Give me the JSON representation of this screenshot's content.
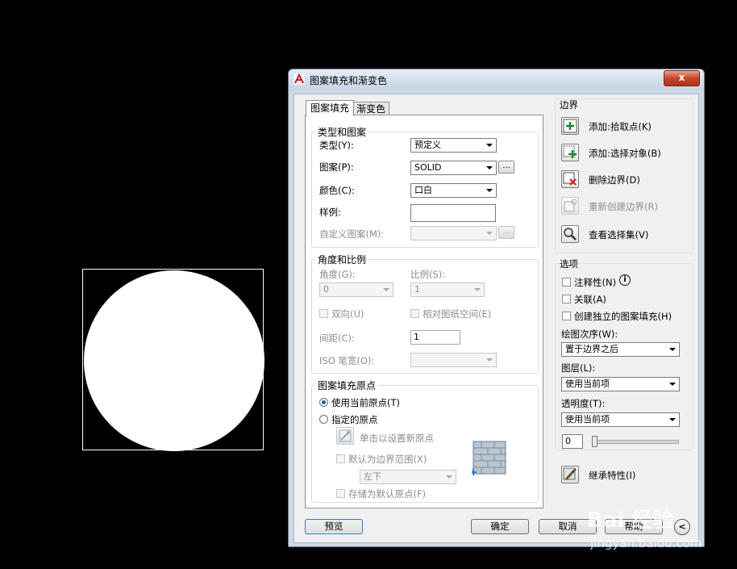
{
  "dialog": {
    "title": "图案填充和渐变色",
    "close_label": "x",
    "tabs": [
      {
        "label": "图案填充"
      },
      {
        "label": "渐变色"
      }
    ]
  },
  "type_pattern": {
    "legend": "类型和图案",
    "type_label": "类型(Y):",
    "type_value": "预定义",
    "pattern_label": "图案(P):",
    "pattern_value": "SOLID",
    "color_label": "颜色(C):",
    "color_value": "口白",
    "swatch_label": "样例:",
    "custom_label": "自定义图案(M):",
    "ellipsis": "..."
  },
  "angle_scale": {
    "legend": "角度和比例",
    "angle_label": "角度(G):",
    "angle_value": "0",
    "scale_label": "比例(S):",
    "scale_value": "1",
    "double_label": "双向(U)",
    "relative_label": "相对图纸空间(E)",
    "spacing_label": "间距(C):",
    "spacing_value": "1",
    "iso_label": "ISO 笔宽(O):"
  },
  "origin": {
    "legend": "图案填充原点",
    "use_current": "使用当前原点(T)",
    "specified": "指定的原点",
    "click_set": "单击以设置新原点",
    "default_extents": "默认为边界范围(X)",
    "position_value": "左下",
    "store_default": "存储为默认原点(F)"
  },
  "boundary": {
    "title": "边界",
    "add_pick": "添加:拾取点(K)",
    "add_select": "添加:选择对象(B)",
    "remove": "删除边界(D)",
    "recreate": "重新创建边界(R)",
    "view_selection": "查看选择集(V)"
  },
  "options": {
    "title": "选项",
    "annotative": "注释性(N)",
    "info_glyph": "i",
    "associative": "关联(A)",
    "separate": "创建独立的图案填充(H)",
    "draw_order_label": "绘图次序(W):",
    "draw_order_value": "置于边界之后",
    "layer_label": "图层(L):",
    "layer_value": "使用当前项",
    "transparency_label": "透明度(T):",
    "transparency_value": "使用当前项",
    "transparency_number": "0",
    "inherit": "继承特性(I)"
  },
  "footer": {
    "preview": "预览",
    "ok": "确定",
    "cancel": "取消",
    "help": "帮助",
    "more_glyph": "<"
  },
  "watermark": {
    "brand": "Bai 经验",
    "url": "jingyan.baidu.com"
  }
}
